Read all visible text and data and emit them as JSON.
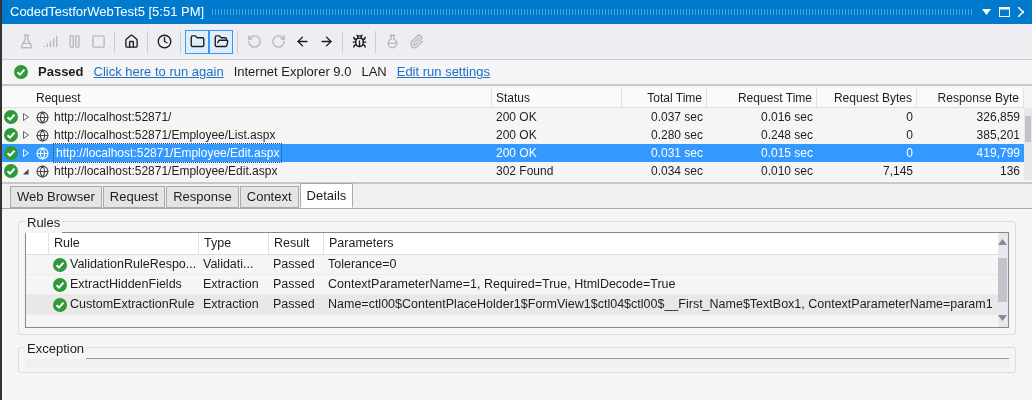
{
  "window": {
    "title": "CodedTestforWebTest5 [5:51 PM]"
  },
  "toolbar": [
    [
      {
        "disabled": true,
        "selected": false
      },
      {
        "disabled": true,
        "selected": false
      },
      {
        "disabled": true,
        "selected": false
      },
      {
        "disabled": true,
        "selected": false
      }
    ],
    [
      {
        "disabled": false,
        "selected": false
      }
    ],
    [
      {
        "disabled": false,
        "selected": false
      }
    ],
    [
      {
        "disabled": false,
        "selected": true
      },
      {
        "disabled": false,
        "selected": true
      }
    ],
    [
      {
        "disabled": true,
        "selected": false
      },
      {
        "disabled": true,
        "selected": false
      },
      {
        "disabled": false,
        "selected": false
      },
      {
        "disabled": false,
        "selected": false
      }
    ],
    [
      {
        "disabled": false,
        "selected": false
      }
    ],
    [
      {
        "disabled": true,
        "selected": false
      },
      {
        "disabled": true,
        "selected": false
      }
    ]
  ],
  "result_bar": {
    "passed": true,
    "result": "Passed",
    "run_again_link": "Click here to run again",
    "browser": "Internet Explorer 9.0",
    "network": "LAN",
    "settings_link": "Edit run settings"
  },
  "requests": {
    "columns": [
      "Request",
      "Status",
      "Total Time",
      "Request Time",
      "Request Bytes",
      "Response Byte"
    ],
    "rows": [
      {
        "passed": true,
        "expanded": false,
        "selected": false,
        "cells": [
          "http://localhost:52871/",
          "200 OK",
          "0.037 sec",
          "0.016 sec",
          "0",
          "326,859"
        ]
      },
      {
        "passed": true,
        "expanded": false,
        "selected": false,
        "cells": [
          "http://localhost:52871/Employee/List.aspx",
          "200 OK",
          "0.280 sec",
          "0.248 sec",
          "0",
          "385,201"
        ]
      },
      {
        "passed": true,
        "expanded": false,
        "selected": true,
        "cells": [
          "http://localhost:52871/Employee/Edit.aspx",
          "200 OK",
          "0.031 sec",
          "0.015 sec",
          "0",
          "419,799"
        ]
      },
      {
        "passed": true,
        "expanded": true,
        "selected": false,
        "cells": [
          "http://localhost:52871/Employee/Edit.aspx",
          "302 Found",
          "0.034 sec",
          "0.010 sec",
          "7,145",
          "136"
        ]
      }
    ]
  },
  "tabs": [
    {
      "label": "Web Browser",
      "selected": false
    },
    {
      "label": "Request",
      "selected": false
    },
    {
      "label": "Response",
      "selected": false
    },
    {
      "label": "Context",
      "selected": false
    },
    {
      "label": "Details",
      "selected": true
    }
  ],
  "rules": {
    "title": "Rules",
    "columns": [
      "Rule",
      "Type",
      "Result",
      "Parameters"
    ],
    "rows": [
      {
        "passed": true,
        "selected": false,
        "cells": [
          "ValidationRuleRespo...",
          "Validati...",
          "Passed",
          "Tolerance=0"
        ]
      },
      {
        "passed": true,
        "selected": false,
        "cells": [
          "ExtractHiddenFields",
          "Extraction",
          "Passed",
          "ContextParameterName=1, Required=True, HtmlDecode=True"
        ]
      },
      {
        "passed": true,
        "selected": true,
        "cells": [
          "CustomExtractionRule",
          "Extraction",
          "Passed",
          "Name=ctl00$ContentPlaceHolder1$FormView1$ctl04$ctl00$__First_Name$TextBox1, ContextParameterName=param1"
        ]
      }
    ]
  },
  "exception": {
    "title": "Exception"
  }
}
